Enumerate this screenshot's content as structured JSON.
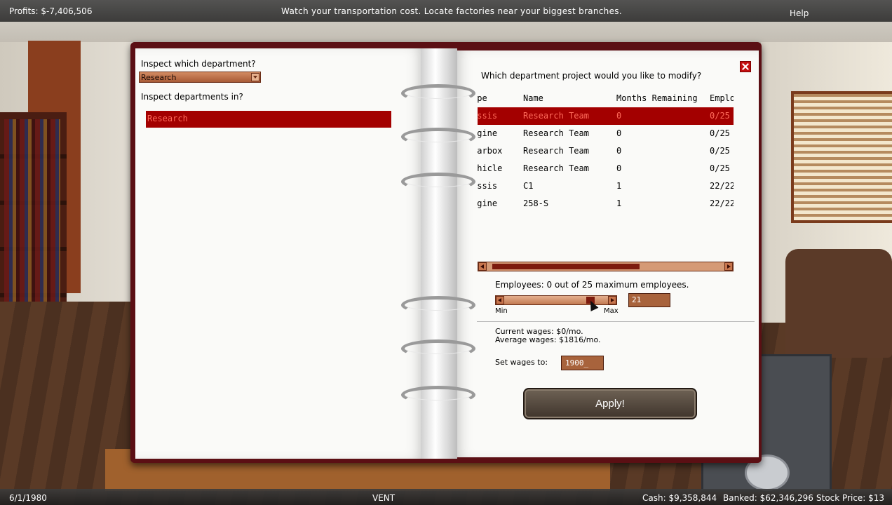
{
  "topbar": {
    "profits": "Profits: $-7,406,506",
    "tip": "Watch your transportation cost. Locate factories near your biggest branches.",
    "help": "Help"
  },
  "left_page": {
    "inspect_label": "Inspect which department?",
    "dept_select_value": "Research",
    "inspect_in_label": "Inspect departments in?",
    "dept_list": [
      "Research"
    ]
  },
  "right_page": {
    "question": "Which department project would you like to modify?",
    "table": {
      "headers": [
        "ype",
        "Name",
        "Months Remaining",
        "Emplo"
      ],
      "rows": [
        {
          "type": "assis",
          "name": "Research Team",
          "months": "0",
          "employees": "0/25",
          "selected": true
        },
        {
          "type": "igine",
          "name": "Research Team",
          "months": "0",
          "employees": "0/25"
        },
        {
          "type": "earbox",
          "name": "Research Team",
          "months": "0",
          "employees": "0/25"
        },
        {
          "type": "ehicle",
          "name": "Research Team",
          "months": "0",
          "employees": "0/25"
        },
        {
          "type": "assis",
          "name": "C1",
          "months": "1",
          "employees": "22/22"
        },
        {
          "type": "igine",
          "name": "258-S",
          "months": "1",
          "employees": "22/22"
        }
      ]
    },
    "employees_text": "Employees:  0  out  of  25  maximum  employees.",
    "slider_min": "Min",
    "slider_max": "Max",
    "employee_input": "21",
    "current_wages": "Current  wages:  $0/mo.",
    "average_wages": "Average  wages:  $1816/mo.",
    "set_wages_label": "Set  wages  to:",
    "wage_input": "1900_",
    "apply": "Apply!"
  },
  "bottombar": {
    "date": "6/1/1980",
    "center": "VENT",
    "cash": "Cash:  $9,358,844",
    "banked": "Banked:  $62,346,296",
    "stock": "Stock  Price:  $13"
  }
}
